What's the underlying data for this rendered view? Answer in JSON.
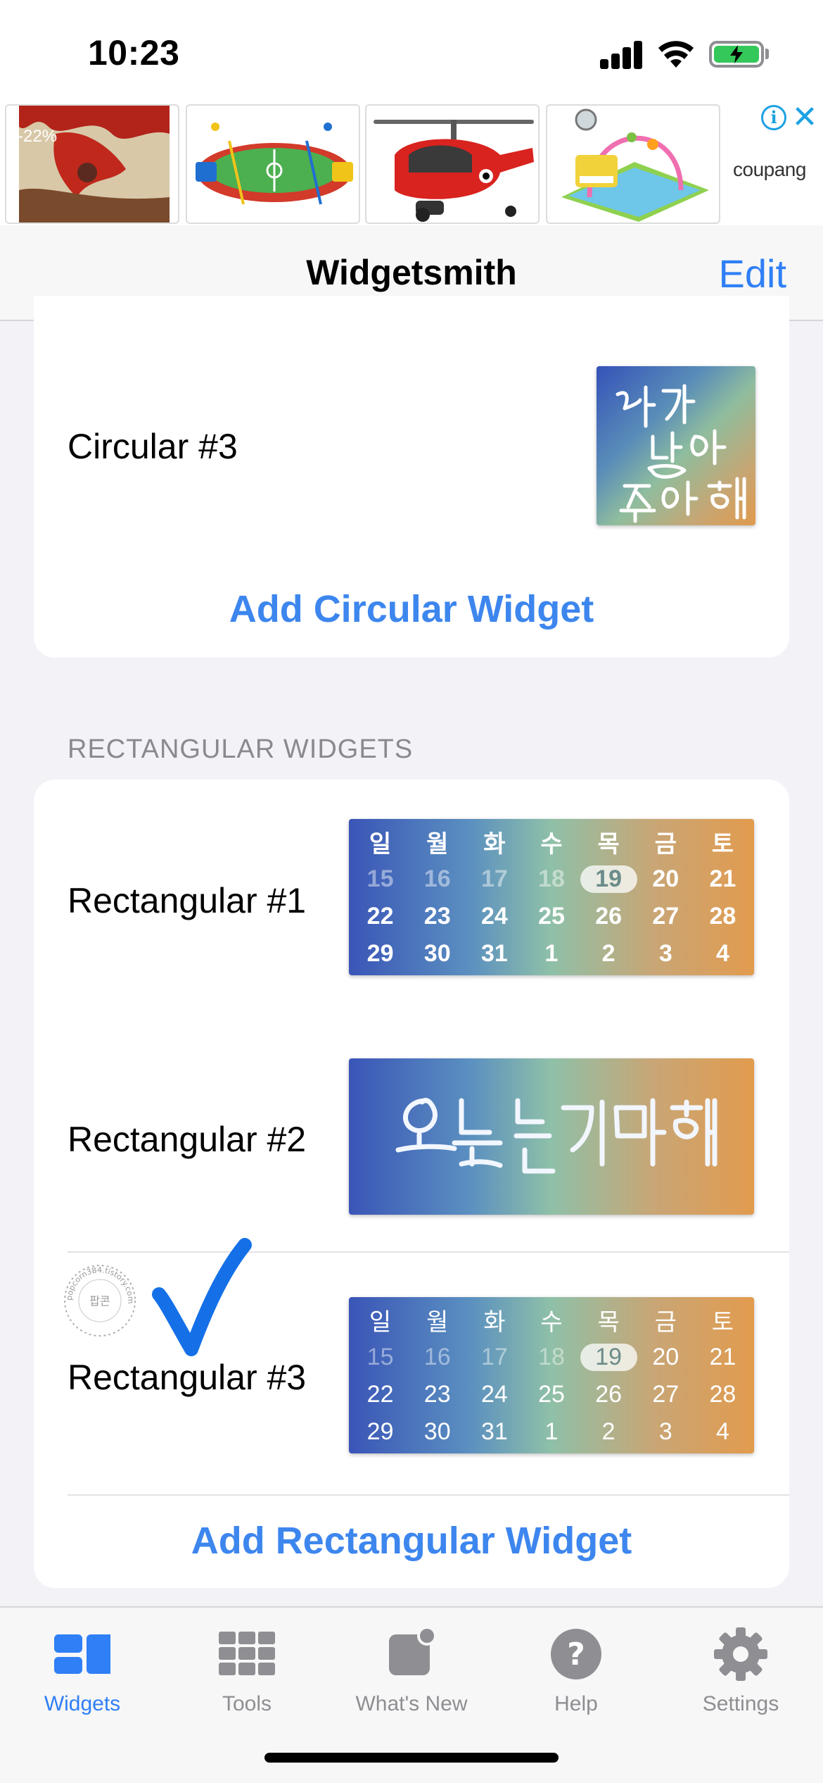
{
  "status_bar": {
    "time": "10:23"
  },
  "ad": {
    "discount_badge": "-22%",
    "brand": "coupang",
    "info_icon": "info-circle-icon",
    "close_icon": "close-icon",
    "products": [
      "art-figure-image",
      "foosball-toy-image",
      "helicopter-toy-image",
      "baby-play-gym-image"
    ]
  },
  "nav": {
    "title": "Widgetsmith",
    "edit_label": "Edit"
  },
  "circular_section": {
    "rows": [
      {
        "label": "Circular #3",
        "thumb_text": "내가 많이 좋아해"
      }
    ],
    "add_label": "Add Circular Widget"
  },
  "rectangular_section": {
    "header": "RECTANGULAR WIDGETS",
    "rows": [
      {
        "label": "Rectangular #1",
        "type": "calendar"
      },
      {
        "label": "Rectangular #2",
        "type": "text",
        "thumb_text": "오늘도 고마워"
      },
      {
        "label": "Rectangular #3",
        "type": "calendar"
      }
    ],
    "add_label": "Add Rectangular Widget",
    "watermark_text": "popcorn384.tistory.com 팝콘"
  },
  "calendar": {
    "weekdays": [
      "일",
      "월",
      "화",
      "수",
      "목",
      "금",
      "토"
    ],
    "weeks": [
      [
        "15",
        "16",
        "17",
        "18",
        "19",
        "20",
        "21"
      ],
      [
        "22",
        "23",
        "24",
        "25",
        "26",
        "27",
        "28"
      ],
      [
        "29",
        "30",
        "31",
        "1",
        "2",
        "3",
        "4"
      ]
    ],
    "today": "19"
  },
  "tab_bar": {
    "tabs": [
      {
        "label": "Widgets",
        "icon": "widgets-icon",
        "active": true
      },
      {
        "label": "Tools",
        "icon": "grid-icon",
        "active": false
      },
      {
        "label": "What's New",
        "icon": "whats-new-icon",
        "active": false
      },
      {
        "label": "Help",
        "icon": "help-icon",
        "active": false
      },
      {
        "label": "Settings",
        "icon": "gear-icon",
        "active": false
      }
    ]
  },
  "colors": {
    "accent": "#2f7ff6",
    "link": "#3d86ee",
    "battery": "#34c759",
    "ad_icon": "#1ba1e2"
  }
}
